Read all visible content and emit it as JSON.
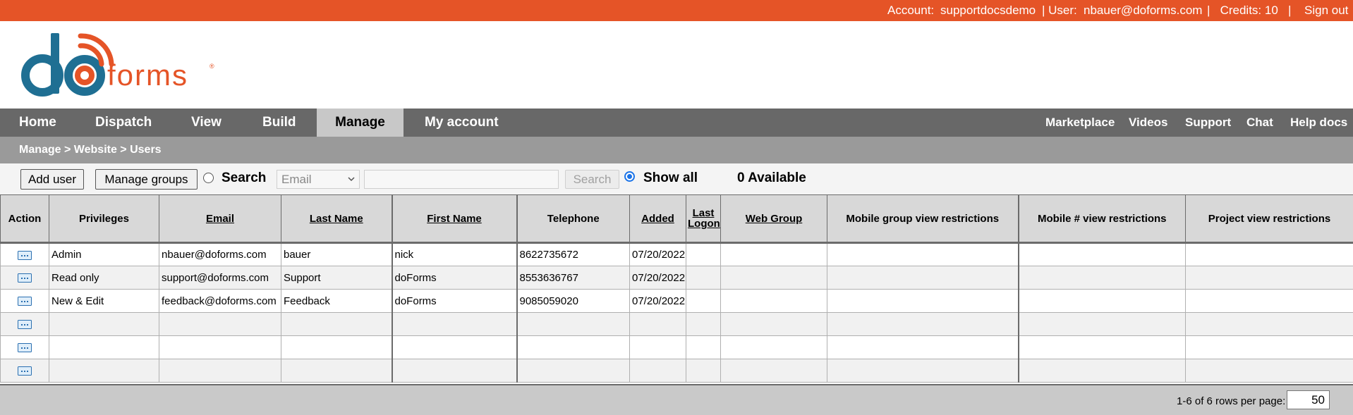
{
  "topbar": {
    "account_label": "Account:",
    "account_value": "supportdocsdemo",
    "user_label": "| User:",
    "user_value": "nbauer@doforms.com",
    "credits": "|   Credits: 10   |",
    "signout": "Sign out"
  },
  "logo": {
    "do": "do",
    "forms": "forms"
  },
  "nav": {
    "items": [
      "Home",
      "Dispatch",
      "View",
      "Build",
      "Manage",
      "My account"
    ],
    "active": "Manage",
    "right": [
      "Marketplace",
      "Videos",
      "Support",
      "Chat",
      "Help docs"
    ]
  },
  "breadcrumb": "Manage > Website > Users",
  "toolbar": {
    "add_user": "Add user",
    "manage_groups": "Manage groups",
    "search_label": "Search",
    "search_field": "Email",
    "search_button": "Search",
    "show_all": "Show all",
    "available": "0 Available"
  },
  "table": {
    "headers": [
      "Action",
      "Privileges",
      "Email",
      "Last Name",
      "First Name",
      "Telephone",
      "Added",
      "Last Logon",
      "Web Group",
      "Mobile group view restrictions",
      "Mobile # view restrictions",
      "Project view restrictions"
    ],
    "rows": [
      [
        "Admin",
        "nbauer@doforms.com",
        "bauer",
        "nick",
        "8622735672",
        "07/20/2022",
        "",
        "",
        "",
        "",
        ""
      ],
      [
        "Read only",
        "support@doforms.com",
        "Support",
        "doForms",
        "8553636767",
        "07/20/2022",
        "",
        "",
        "",
        "",
        ""
      ],
      [
        "New & Edit",
        "feedback@doforms.com",
        "Feedback",
        "doForms",
        "9085059020",
        "07/20/2022",
        "",
        "",
        "",
        "",
        ""
      ],
      [
        "",
        "",
        "",
        "",
        "",
        "",
        "",
        "",
        "",
        "",
        ""
      ],
      [
        "",
        "",
        "",
        "",
        "",
        "",
        "",
        "",
        "",
        "",
        ""
      ],
      [
        "",
        "",
        "",
        "",
        "",
        "",
        "",
        "",
        "",
        "",
        ""
      ]
    ]
  },
  "footer": {
    "info": "1-6 of 6 rows per page:",
    "rows_per_page": "50"
  },
  "colors": {
    "topbar": "#e55427",
    "nav": "#686868",
    "nav_active": "#c8c8c8",
    "breadcrumb": "#9a9a9a",
    "logo_blue": "#1f6f93",
    "logo_orange": "#e55427"
  }
}
